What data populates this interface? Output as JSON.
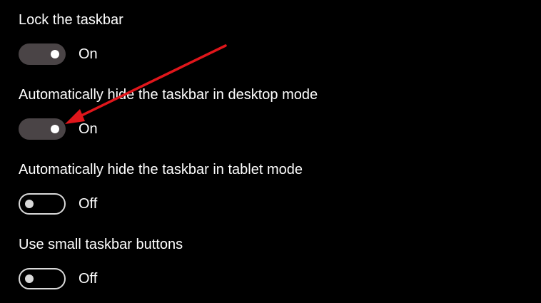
{
  "settings": [
    {
      "label": "Lock the taskbar",
      "state": "On",
      "enabled": true
    },
    {
      "label": "Automatically hide the taskbar in desktop mode",
      "state": "On",
      "enabled": true
    },
    {
      "label": "Automatically hide the taskbar in tablet mode",
      "state": "Off",
      "enabled": false
    },
    {
      "label": "Use small taskbar buttons",
      "state": "Off",
      "enabled": false
    }
  ],
  "annotation": {
    "icon": "red-arrow-icon",
    "color": "#e0161b"
  }
}
